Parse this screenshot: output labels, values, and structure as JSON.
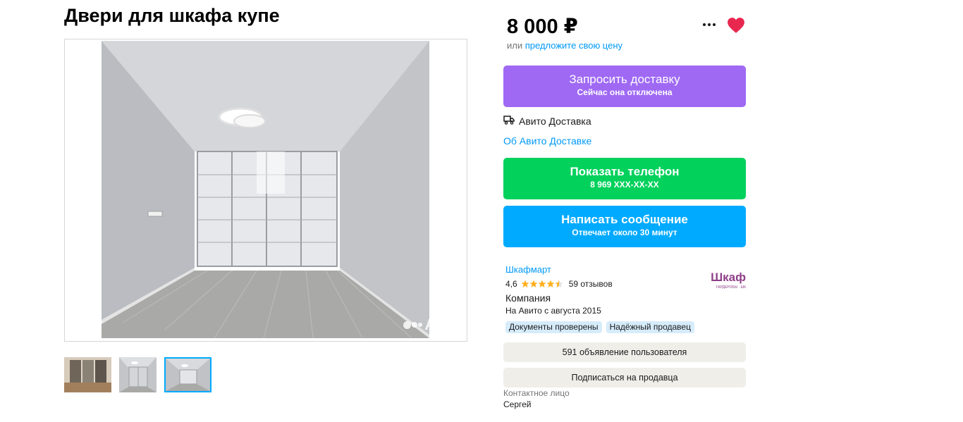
{
  "listing": {
    "title": "Двери для шкафа купе"
  },
  "gallery": {
    "watermark": "Avito",
    "thumbnails": [
      "wardrobe-doors-photo-1",
      "wardrobe-doors-photo-2",
      "wardrobe-doors-photo-3"
    ],
    "selected_index": 3
  },
  "price": {
    "value": "8 000 ₽",
    "alt_prefix": "или",
    "alt_link": "предложите свою цену"
  },
  "actions": {
    "more_icon": "more-dots-icon",
    "favorite_icon": "heart-icon",
    "favorite_color": "#e8284f"
  },
  "delivery": {
    "button_title": "Запросить доставку",
    "button_subtitle": "Сейчас она отключена",
    "service_icon": "truck-icon",
    "service_name": "Авито Доставка",
    "info_link": "Об Авито Доставке",
    "color": "#9f69f4"
  },
  "phone": {
    "button_title": "Показать телефон",
    "masked_number": "8 969 XXX-XX-XX",
    "color": "#02d15c"
  },
  "message": {
    "button_title": "Написать сообщение",
    "response_time": "Отвечает около 30 минут",
    "color": "#00aaff"
  },
  "seller": {
    "name": "Шкафмарт",
    "rating": "4,6",
    "stars": 4.5,
    "reviews": "59 отзывов",
    "type": "Компания",
    "since": "На Авито с августа 2015",
    "logo_text": "Шкаф",
    "logo_subtext": "ГАРДЕРОБЫ · ШК",
    "badges": [
      "Документы проверены",
      "Надёжный продавец"
    ],
    "ads_button": "591 объявление пользователя",
    "subscribe_button": "Подписаться на продавца",
    "contact_label": "Контактное лицо",
    "contact_name": "Сергей"
  }
}
